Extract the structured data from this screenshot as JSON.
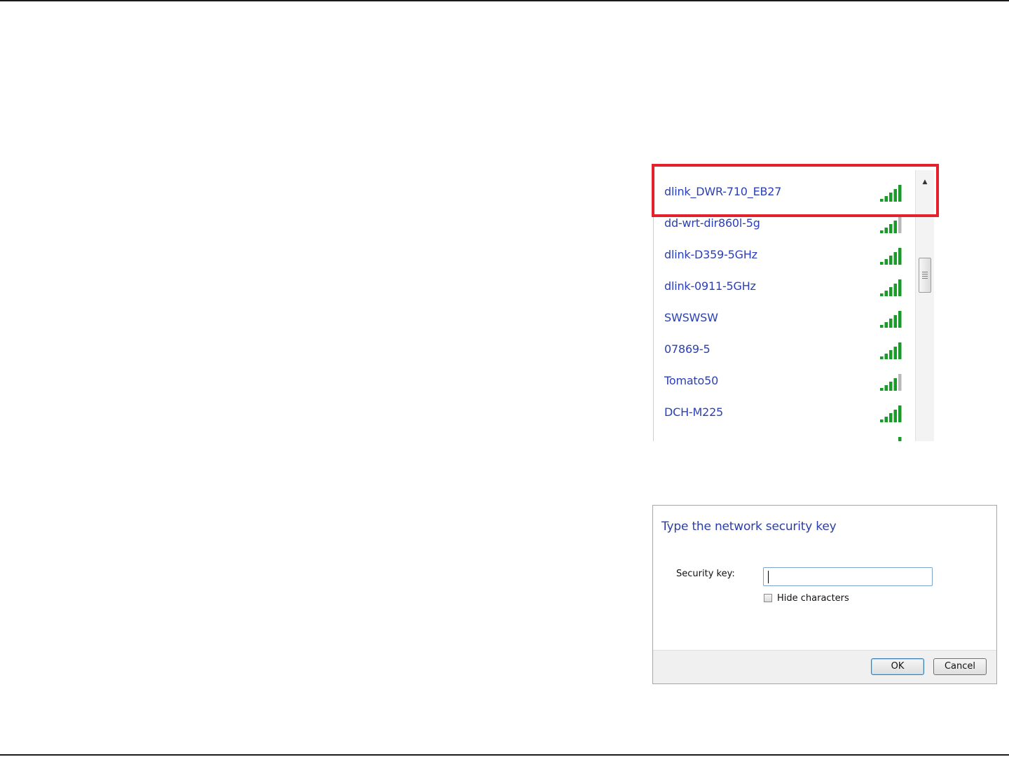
{
  "networks": {
    "items": [
      {
        "name": "dlink_DWR-710_EB27",
        "bars": 5
      },
      {
        "name": "dd-wrt-dir860l-5g",
        "bars": 4
      },
      {
        "name": "dlink-D359-5GHz",
        "bars": 5
      },
      {
        "name": "dlink-0911-5GHz",
        "bars": 5
      },
      {
        "name": "SWSWSW",
        "bars": 5
      },
      {
        "name": "07869-5",
        "bars": 5
      },
      {
        "name": "Tomato50",
        "bars": 4
      },
      {
        "name": "DCH-M225",
        "bars": 5
      },
      {
        "name": "",
        "bars": 5
      }
    ],
    "highlighted_index": 0,
    "scroll_up_glyph": "▲",
    "signal_icon": "wifi-signal-icon",
    "colors": {
      "name": "#2a3fb6",
      "signal_on": "#1a9a28",
      "signal_off": "#b8b8b8",
      "highlight": "#e3222b"
    }
  },
  "dialog": {
    "title": "Type the network security key",
    "security_key_label": "Security key:",
    "security_key_value": "",
    "hide_characters_label": "Hide characters",
    "hide_characters_checked": false,
    "ok_label": "OK",
    "cancel_label": "Cancel"
  }
}
